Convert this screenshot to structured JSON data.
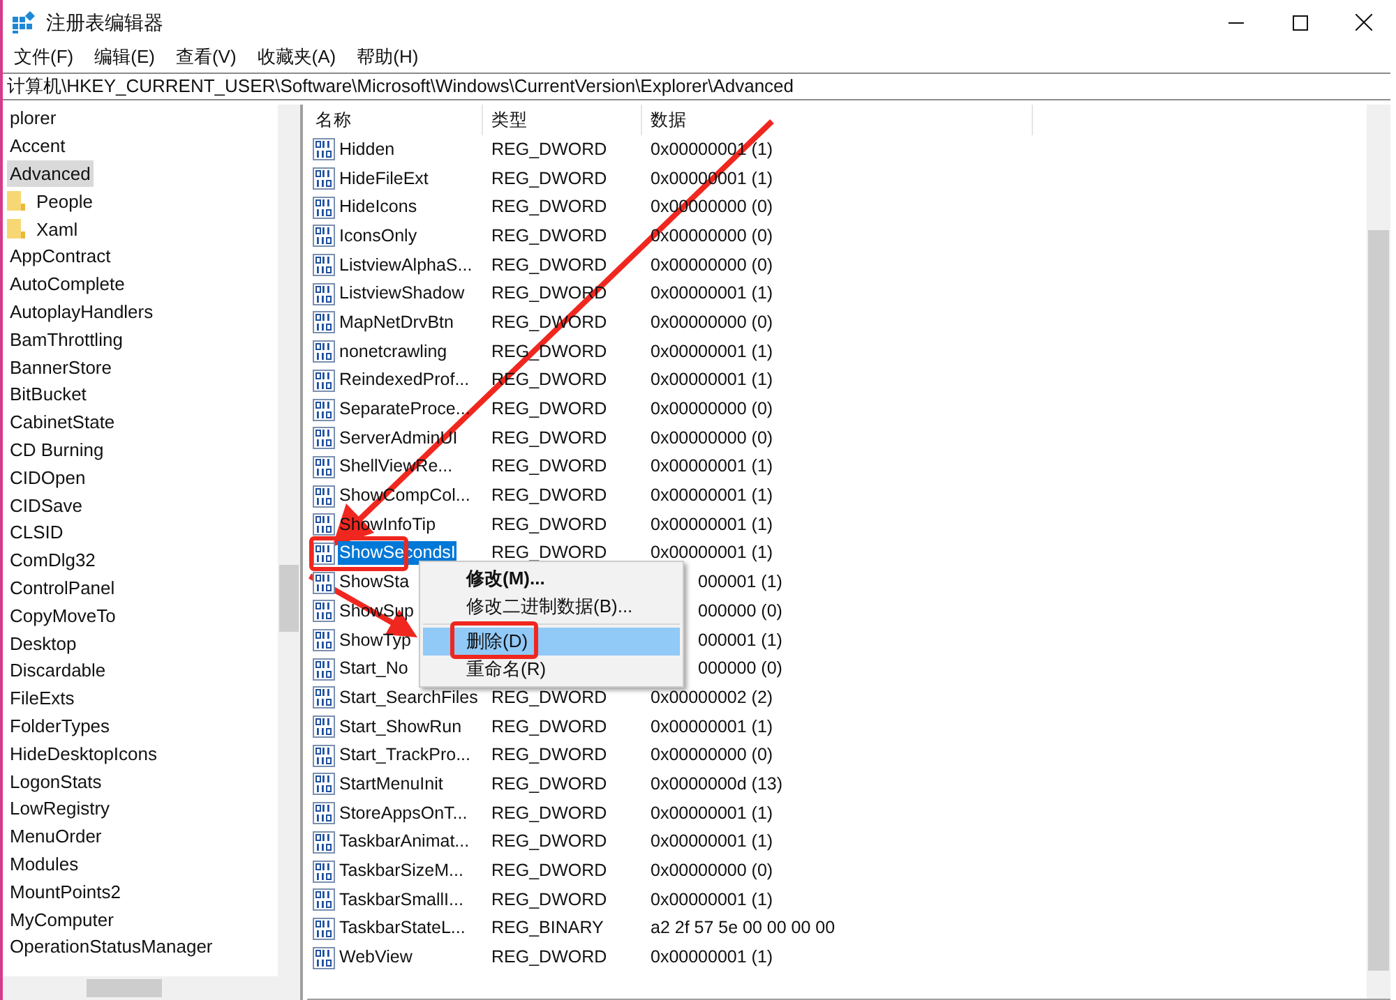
{
  "window": {
    "title": "注册表编辑器"
  },
  "menu_bar": [
    "文件(F)",
    "编辑(E)",
    "查看(V)",
    "收藏夹(A)",
    "帮助(H)"
  ],
  "address": "计算机\\HKEY_CURRENT_USER\\Software\\Microsoft\\Windows\\CurrentVersion\\Explorer\\Advanced",
  "tree": [
    {
      "label": "plorer",
      "selected": false
    },
    {
      "label": "Accent",
      "selected": false
    },
    {
      "label": "Advanced",
      "selected": true,
      "children": [
        {
          "label": "People",
          "selected": false
        },
        {
          "label": "Xaml",
          "selected": false
        }
      ]
    },
    {
      "label": "AppContract",
      "selected": false
    },
    {
      "label": "AutoComplete",
      "selected": false
    },
    {
      "label": "AutoplayHandlers",
      "selected": false
    },
    {
      "label": "BamThrottling",
      "selected": false
    },
    {
      "label": "BannerStore",
      "selected": false
    },
    {
      "label": "BitBucket",
      "selected": false
    },
    {
      "label": "CabinetState",
      "selected": false
    },
    {
      "label": "CD Burning",
      "selected": false
    },
    {
      "label": "CIDOpen",
      "selected": false
    },
    {
      "label": "CIDSave",
      "selected": false
    },
    {
      "label": "CLSID",
      "selected": false
    },
    {
      "label": "ComDlg32",
      "selected": false
    },
    {
      "label": "ControlPanel",
      "selected": false
    },
    {
      "label": "CopyMoveTo",
      "selected": false
    },
    {
      "label": "Desktop",
      "selected": false
    },
    {
      "label": "Discardable",
      "selected": false
    },
    {
      "label": "FileExts",
      "selected": false
    },
    {
      "label": "FolderTypes",
      "selected": false
    },
    {
      "label": "HideDesktopIcons",
      "selected": false
    },
    {
      "label": "LogonStats",
      "selected": false
    },
    {
      "label": "LowRegistry",
      "selected": false
    },
    {
      "label": "MenuOrder",
      "selected": false
    },
    {
      "label": "Modules",
      "selected": false
    },
    {
      "label": "MountPoints2",
      "selected": false
    },
    {
      "label": "MyComputer",
      "selected": false
    },
    {
      "label": "OperationStatusManager",
      "selected": false
    }
  ],
  "table": {
    "columns": [
      "名称",
      "类型",
      "数据"
    ],
    "rows": [
      {
        "name": "Hidden",
        "type": "REG_DWORD",
        "data": "0x00000001 (1)",
        "selected": false
      },
      {
        "name": "HideFileExt",
        "type": "REG_DWORD",
        "data": "0x00000001 (1)",
        "selected": false
      },
      {
        "name": "HideIcons",
        "type": "REG_DWORD",
        "data": "0x00000000 (0)",
        "selected": false
      },
      {
        "name": "IconsOnly",
        "type": "REG_DWORD",
        "data": "0x00000000 (0)",
        "selected": false
      },
      {
        "name": "ListviewAlphaS...",
        "type": "REG_DWORD",
        "data": "0x00000000 (0)",
        "selected": false
      },
      {
        "name": "ListviewShadow",
        "type": "REG_DWORD",
        "data": "0x00000001 (1)",
        "selected": false
      },
      {
        "name": "MapNetDrvBtn",
        "type": "REG_DWORD",
        "data": "0x00000000 (0)",
        "selected": false
      },
      {
        "name": "nonetcrawling",
        "type": "REG_DWORD",
        "data": "0x00000001 (1)",
        "selected": false
      },
      {
        "name": "ReindexedProf...",
        "type": "REG_DWORD",
        "data": "0x00000001 (1)",
        "selected": false
      },
      {
        "name": "SeparateProce...",
        "type": "REG_DWORD",
        "data": "0x00000000 (0)",
        "selected": false
      },
      {
        "name": "ServerAdminUI",
        "type": "REG_DWORD",
        "data": "0x00000000 (0)",
        "selected": false
      },
      {
        "name": "ShellViewRe...",
        "type": "REG_DWORD",
        "data": "0x00000001 (1)",
        "selected": false
      },
      {
        "name": "ShowCompCol...",
        "type": "REG_DWORD",
        "data": "0x00000001 (1)",
        "selected": false
      },
      {
        "name": "ShowInfoTip",
        "type": "REG_DWORD",
        "data": "0x00000001 (1)",
        "selected": false
      },
      {
        "name": "ShowSecondsI",
        "type": "REG_DWORD",
        "data": "0x00000001 (1)",
        "selected": true
      },
      {
        "name": "ShowSta",
        "data": "000001 (1)",
        "selected": false
      },
      {
        "name": "ShowSup",
        "data": "000000 (0)",
        "selected": false
      },
      {
        "name": "ShowTyp",
        "data": "000001 (1)",
        "selected": false
      },
      {
        "name": "Start_No",
        "data": "000000 (0)",
        "selected": false
      },
      {
        "name": "Start_SearchFiles",
        "type": "REG_DWORD",
        "data": "0x00000002 (2)",
        "selected": false
      },
      {
        "name": "Start_ShowRun",
        "type": "REG_DWORD",
        "data": "0x00000001 (1)",
        "selected": false
      },
      {
        "name": "Start_TrackPro...",
        "type": "REG_DWORD",
        "data": "0x00000000 (0)",
        "selected": false
      },
      {
        "name": "StartMenuInit",
        "type": "REG_DWORD",
        "data": "0x0000000d (13)",
        "selected": false
      },
      {
        "name": "StoreAppsOnT...",
        "type": "REG_DWORD",
        "data": "0x00000001 (1)",
        "selected": false
      },
      {
        "name": "TaskbarAnimat...",
        "type": "REG_DWORD",
        "data": "0x00000001 (1)",
        "selected": false
      },
      {
        "name": "TaskbarSizeM...",
        "type": "REG_DWORD",
        "data": "0x00000000 (0)",
        "selected": false
      },
      {
        "name": "TaskbarSmallI...",
        "type": "REG_DWORD",
        "data": "0x00000001 (1)",
        "selected": false
      },
      {
        "name": "TaskbarStateL...",
        "type": "REG_BINARY",
        "data": "a2 2f 57 5e 00 00 00 00",
        "selected": false
      },
      {
        "name": "WebView",
        "type": "REG_DWORD",
        "data": "0x00000001 (1)",
        "selected": false
      }
    ]
  },
  "context_menu": [
    {
      "kind": "item",
      "label": "修改(M)...",
      "default": true,
      "selected": false
    },
    {
      "kind": "item",
      "label": "修改二进制数据(B)...",
      "default": false,
      "selected": false
    },
    {
      "kind": "separator"
    },
    {
      "kind": "item",
      "label": "删除(D)",
      "default": false,
      "selected": true
    },
    {
      "kind": "item",
      "label": "重命名(R)",
      "default": false,
      "selected": false
    }
  ]
}
